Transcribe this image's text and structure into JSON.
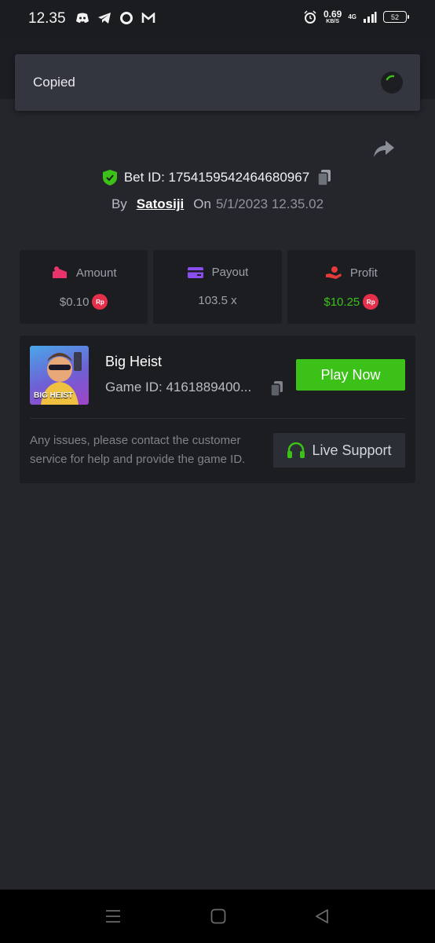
{
  "status_bar": {
    "time": "12.35",
    "net_speed": "0.69",
    "net_speed_unit": "KB/S",
    "network": "4G",
    "battery": "52"
  },
  "toast": {
    "text": "Copied"
  },
  "bet": {
    "id_label": "Bet ID: 1754159542464680967",
    "by_label": "By",
    "user": "Satosiji",
    "on_label": "On",
    "date": "5/1/2023 12.35.02"
  },
  "stats": {
    "amount": {
      "label": "Amount",
      "value": "$0.10",
      "currency": "Rp"
    },
    "payout": {
      "label": "Payout",
      "value": "103.5 x"
    },
    "profit": {
      "label": "Profit",
      "value": "$10.25",
      "currency": "Rp"
    }
  },
  "game": {
    "name": "Big Heist",
    "id_text": "Game ID: 4161889400...",
    "thumb_label": "BIG HEIST",
    "play_label": "Play Now",
    "notice": "Any issues, please contact the customer service for help and provide the game ID.",
    "support_label": "Live Support"
  },
  "colors": {
    "accent_green": "#3bc117",
    "rp_badge": "#e4304a",
    "amount_icon": "#e8336b",
    "payout_icon": "#8a4df0",
    "profit_icon": "#e53a3a"
  }
}
